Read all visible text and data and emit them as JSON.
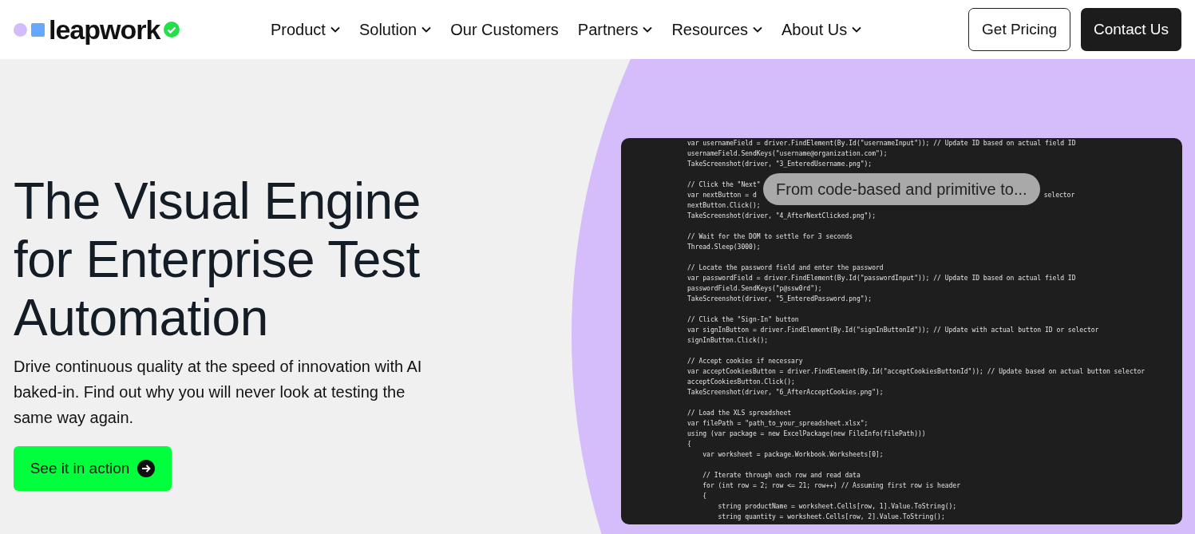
{
  "logo": {
    "text": "leapwork"
  },
  "nav": [
    {
      "label": "Product",
      "has_menu": true
    },
    {
      "label": "Solution",
      "has_menu": true
    },
    {
      "label": "Our Customers",
      "has_menu": false
    },
    {
      "label": "Partners",
      "has_menu": true
    },
    {
      "label": "Resources",
      "has_menu": true
    },
    {
      "label": "About Us",
      "has_menu": true
    }
  ],
  "header_buttons": [
    {
      "label": "Get Pricing",
      "kind": "outline"
    },
    {
      "label": "Contact Us",
      "kind": "filled"
    }
  ],
  "hero": {
    "title_lines": [
      "The Visual Engine",
      "for Enterprise Test",
      "Automation"
    ],
    "subtitle": "Drive continuous quality at the speed of innovation with AI baked-in. Find out why you will never look at testing the same way again.",
    "cta": "See it in action"
  },
  "video": {
    "caption": "From code-based and primitive to...",
    "code_lines": [
      {
        "text": "var usernameField = driver.FindElement(By.Id(\"usernameInput\")); // Update ID based on actual field ID"
      },
      {
        "text": "usernameField.SendKeys(\"username@organization.com\");"
      },
      {
        "text": "TakeScreenshot(driver, \"3_EnteredUsername.png\");"
      },
      {
        "kind": "blank"
      },
      {
        "text": "// Click the \"Next\""
      },
      {
        "text": "var nextButton = d",
        "tail": "selector"
      },
      {
        "text": "nextButton.Click();"
      },
      {
        "text": "TakeScreenshot(driver, \"4_AfterNextClicked.png\");"
      },
      {
        "kind": "blank"
      },
      {
        "text": "// Wait for the DOM to settle for 3 seconds"
      },
      {
        "text": "Thread.Sleep(3000);"
      },
      {
        "kind": "blank"
      },
      {
        "text": "// Locate the password field and enter the password"
      },
      {
        "text": "var passwordField = driver.FindElement(By.Id(\"passwordInput\")); // Update ID based on actual field ID"
      },
      {
        "text": "passwordField.SendKeys(\"p@ssw0rd\");"
      },
      {
        "text": "TakeScreenshot(driver, \"5_EnteredPassword.png\");"
      },
      {
        "kind": "blank"
      },
      {
        "text": "// Click the \"Sign-In\" button"
      },
      {
        "text": "var signInButton = driver.FindElement(By.Id(\"signInButtonId\")); // Update with actual button ID or selector"
      },
      {
        "text": "signInButton.Click();"
      },
      {
        "kind": "blank"
      },
      {
        "text": "// Accept cookies if necessary"
      },
      {
        "text": "var acceptCookiesButton = driver.FindElement(By.Id(\"acceptCookiesButtonId\")); // Update based on actual button selector"
      },
      {
        "text": "acceptCookiesButton.Click();"
      },
      {
        "text": "TakeScreenshot(driver, \"6_AfterAcceptCookies.png\");"
      },
      {
        "kind": "blank"
      },
      {
        "text": "// Load the XLS spreadsheet"
      },
      {
        "text": "var filePath = \"path_to_your_spreadsheet.xlsx\";"
      },
      {
        "text": "using (var package = new ExcelPackage(new FileInfo(filePath)))"
      },
      {
        "text": "{"
      },
      {
        "text": "    var worksheet = package.Workbook.Worksheets[0];"
      },
      {
        "kind": "blank"
      },
      {
        "text": "    // Iterate through each row and read data"
      },
      {
        "text": "    for (int row = 2; row <= 21; row++) // Assuming first row is header"
      },
      {
        "text": "    {"
      },
      {
        "text": "        string productName = worksheet.Cells[row, 1].Value.ToString();"
      },
      {
        "text": "        string quantity = worksheet.Cells[row, 2].Value.ToString();"
      }
    ]
  }
}
